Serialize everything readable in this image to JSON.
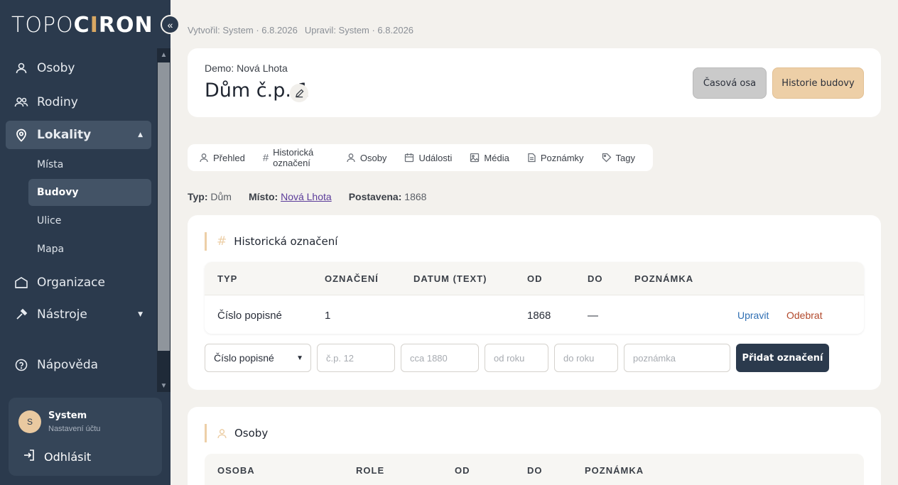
{
  "brand": {
    "logo_left": "TOPO",
    "logo_accent": "C",
    "logo_mid": "I",
    "logo_right": "RON"
  },
  "sidebar": {
    "items": [
      {
        "label": "Osoby"
      },
      {
        "label": "Rodiny"
      },
      {
        "label": "Lokality"
      },
      {
        "label": "Organizace"
      },
      {
        "label": "Nástroje"
      },
      {
        "label": "Nápověda"
      }
    ],
    "subitems": [
      {
        "label": "Místa"
      },
      {
        "label": "Budovy"
      },
      {
        "label": "Ulice"
      },
      {
        "label": "Mapa"
      }
    ],
    "user": {
      "initial": "S",
      "name": "System",
      "sub": "Nastavení účtu",
      "logout": "Odhlásit"
    }
  },
  "meta": {
    "created": "Vytvořil: System · 6.8.2026",
    "updated": "Upravil: System · 6.8.2026"
  },
  "header": {
    "breadcrumb": "Demo: Nová Lhota",
    "title": "Dům č.p. 1",
    "btn_timeline": "Časová osa",
    "btn_history": "Historie budovy"
  },
  "tabs": [
    {
      "label": "Přehled"
    },
    {
      "label": "Historická označení"
    },
    {
      "label": "Osoby"
    },
    {
      "label": "Události"
    },
    {
      "label": "Média"
    },
    {
      "label": "Poznámky"
    },
    {
      "label": "Tagy"
    }
  ],
  "info": {
    "type_label": "Typ:",
    "type_value": "Dům",
    "place_label": "Místo:",
    "place_value": "Nová Lhota",
    "built_label": "Postavena:",
    "built_value": "1868"
  },
  "designations": {
    "title": "Historická označení",
    "columns": [
      "TYP",
      "OZNAČENÍ",
      "DATUM (TEXT)",
      "OD",
      "DO",
      "POZNÁMKA"
    ],
    "rows": [
      {
        "type": "Číslo popisné",
        "label": "1",
        "date_text": "",
        "from": "1868",
        "to": "—",
        "note": "",
        "edit": "Upravit",
        "remove": "Odebrat"
      }
    ],
    "form": {
      "select_value": "Číslo popisné",
      "ph_label": "č.p. 12",
      "ph_date": "cca 1880",
      "ph_from": "od roku",
      "ph_to": "do roku",
      "ph_note": "poznámka",
      "add_button": "Přidat označení"
    }
  },
  "persons": {
    "title": "Osoby",
    "columns": [
      "OSOBA",
      "ROLE",
      "OD",
      "DO",
      "POZNÁMKA"
    ]
  },
  "colors": {
    "sidebar": "#2b3a4d",
    "accent": "#edcfa7",
    "link": "#2f6fb3",
    "danger": "#b2492c"
  }
}
